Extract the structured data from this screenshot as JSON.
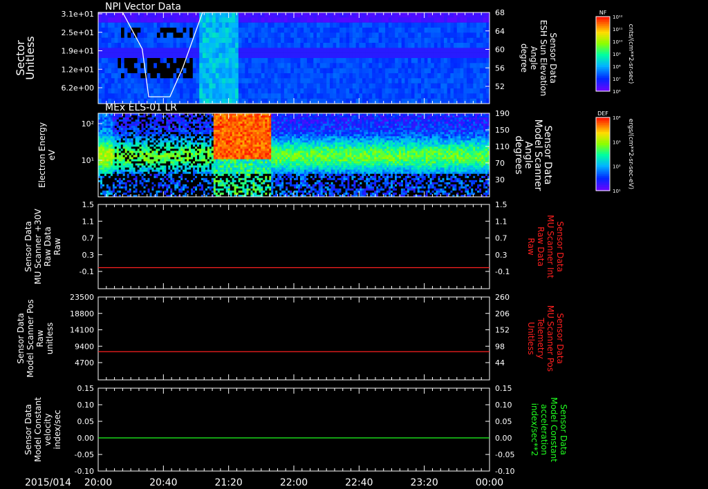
{
  "date_label": "2015/014",
  "time_ticks": [
    "20:00",
    "20:40",
    "21:20",
    "22:00",
    "22:40",
    "23:20",
    "00:00"
  ],
  "chart_data": [
    {
      "type": "heatmap",
      "title": "NPI Vector Data",
      "ylabel": "Sector Unitless",
      "yticks": [
        "3.1e+01",
        "2.5e+01",
        "1.9e+01",
        "1.2e+01",
        "6.2e+00"
      ],
      "ylim": [
        0,
        31
      ],
      "right_ylabel": "Sensor Data ESH Sun Elevation Angle degree",
      "right_yticks": [
        "68",
        "64",
        "60",
        "56",
        "52"
      ],
      "right_ylim": [
        48,
        68
      ],
      "overlay_series": {
        "name": "ESH Sun Elevation Angle",
        "color": "#ffffff",
        "x": [
          "20:00",
          "20:15",
          "20:27",
          "20:31",
          "20:44",
          "20:52",
          "21:04",
          "21:20"
        ],
        "y": [
          68,
          68,
          60,
          49.5,
          49.5,
          56,
          68,
          68
        ]
      },
      "colorbar": {
        "label": "NF",
        "units": "cnts/(cm**2-sr-sec)",
        "ticks": [
          "10¹²",
          "10¹¹",
          "10¹⁰",
          "10⁹",
          "10⁸",
          "10⁷",
          "10⁶"
        ]
      }
    },
    {
      "type": "heatmap",
      "title": "MEx ELS-01 LR",
      "ylabel": "Electron Energy eV",
      "yticks": [
        "10²",
        "10¹"
      ],
      "yscale": "log",
      "right_ylabel": "Sensor Data Model Scanner Angle degrees",
      "right_yticks": [
        "190",
        "150",
        "110",
        "70",
        "30"
      ],
      "right_ylim": [
        10,
        190
      ],
      "colorbar": {
        "label": "DEF",
        "units": "ergs/(cm**2-sr-sec-eV)",
        "ticks": [
          "10⁴",
          "10³",
          "10²",
          "10¹"
        ]
      }
    },
    {
      "type": "line",
      "ylabel": "Sensor Data MU Scanner +30V Raw Data Raw",
      "yticks": [
        "1.5",
        "1.1",
        "0.7",
        "0.3",
        "-0.1"
      ],
      "ylim": [
        -0.5,
        1.5
      ],
      "right_ylabel": "Sensor Data MU Scanner Int Raw Data Raw",
      "right_yticks": [
        "1.5",
        "1.1",
        "0.7",
        "0.3",
        "-0.1"
      ],
      "series": [
        {
          "color": "#ff2020",
          "x": [
            "20:00",
            "00:00"
          ],
          "y": [
            0,
            0
          ]
        }
      ]
    },
    {
      "type": "line",
      "ylabel": "Sensor Data Model Scanner Pos Raw unitless",
      "yticks": [
        "23500",
        "18800",
        "14100",
        "9400",
        "4700"
      ],
      "ylim": [
        0,
        23500
      ],
      "right_ylabel": "Sensor Data MU Scanner Pos Telemetry Unitless",
      "right_yticks": [
        "260",
        "206",
        "152",
        "98",
        "44"
      ],
      "series": [
        {
          "color": "#ff2020",
          "x": [
            "20:00",
            "00:00"
          ],
          "y": [
            8000,
            8000
          ]
        }
      ]
    },
    {
      "type": "line",
      "ylabel": "Sensor Data Model Constant velocity index/sec",
      "yticks": [
        "0.15",
        "0.10",
        "0.05",
        "0.00",
        "-0.05",
        "-0.10"
      ],
      "ylim": [
        -0.1,
        0.15
      ],
      "right_ylabel": "Sensor Data Model Constant acceleration index/sec**2",
      "right_yticks": [
        "0.15",
        "0.10",
        "0.05",
        "0.00",
        "-0.05",
        "-0.10"
      ],
      "series": [
        {
          "color": "#20ff20",
          "x": [
            "20:00",
            "00:00"
          ],
          "y": [
            0,
            0
          ]
        }
      ]
    }
  ]
}
